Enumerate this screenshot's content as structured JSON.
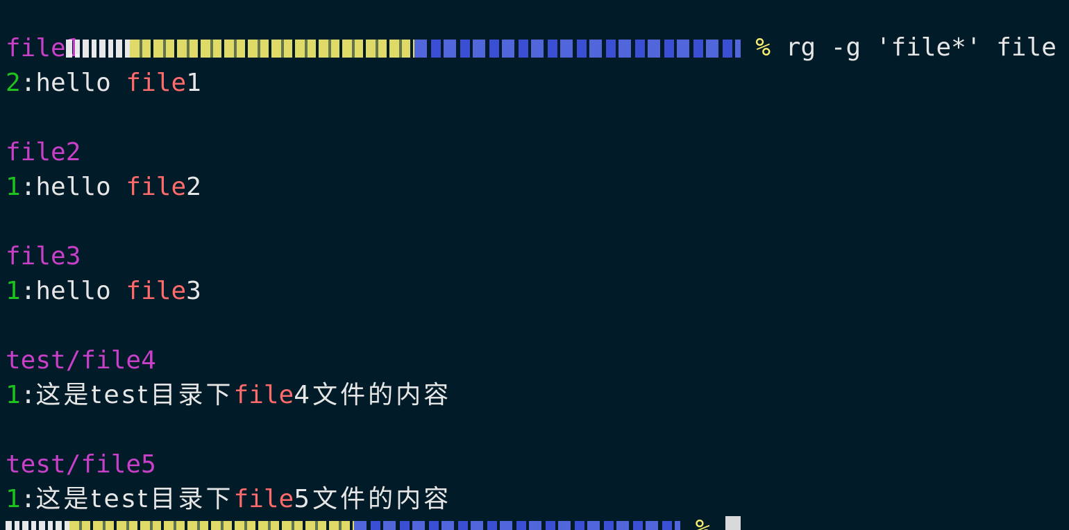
{
  "prompt": {
    "percent": "%",
    "command": "rg -g 'file*' file"
  },
  "results": [
    {
      "path": "file1",
      "line_no": "2",
      "sep": ":",
      "before": "hello ",
      "match": "file",
      "after": "1"
    },
    {
      "path": "file2",
      "line_no": "1",
      "sep": ":",
      "before": "hello ",
      "match": "file",
      "after": "2"
    },
    {
      "path": "file3",
      "line_no": "1",
      "sep": ":",
      "before": "hello ",
      "match": "file",
      "after": "3"
    },
    {
      "path": "test/file4",
      "line_no": "1",
      "sep": ":",
      "before": "这是test目录下",
      "match": "file",
      "after": "4文件的内容"
    },
    {
      "path": "test/file5",
      "line_no": "1",
      "sep": ":",
      "before": "这是test目录下",
      "match": "file",
      "after": "5文件的内容"
    }
  ],
  "next_prompt": {
    "percent": "%"
  },
  "colors": {
    "background": "#021b28",
    "path": "#c83fc8",
    "line_number": "#1ec21e",
    "match": "#ff6b6b",
    "prompt_symbol": "#f8ef6f",
    "text": "#e6e6e6"
  }
}
